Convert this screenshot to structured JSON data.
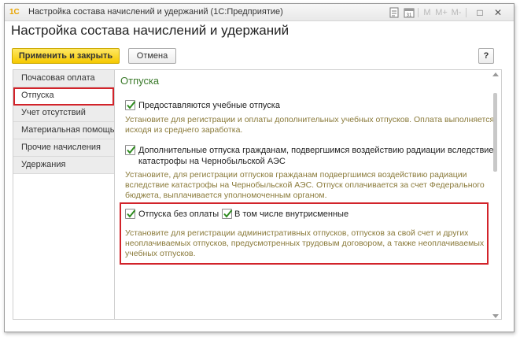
{
  "window": {
    "app_logo": "1С",
    "title": "Настройка состава начислений и удержаний (1С:Предприятие)",
    "toolbar_icons": [
      "document-icon",
      "calendar-icon",
      "memory-m-icon",
      "memory-m-plus-icon",
      "memory-m-minus-icon",
      "restore-icon",
      "close-icon"
    ],
    "mem_m": "M",
    "mem_mplus": "M+",
    "mem_mminus": "M-",
    "restore_glyph": "□",
    "close_glyph": "✕"
  },
  "form": {
    "title": "Настройка состава начислений и удержаний",
    "apply_button": "Применить и закрыть",
    "cancel_button": "Отмена",
    "help_button": "?"
  },
  "sidebar": {
    "items": [
      {
        "label": "Почасовая оплата"
      },
      {
        "label": "Отпуска"
      },
      {
        "label": "Учет отсутствий"
      },
      {
        "label": "Материальная помощь"
      },
      {
        "label": "Прочие начисления"
      },
      {
        "label": "Удержания"
      }
    ],
    "active_index": 1
  },
  "content": {
    "section_title": "Отпуска",
    "options": [
      {
        "label": "Предоставляются учебные отпуска",
        "checked": true,
        "hint_lines": [
          "Установите для регистрации и оплаты дополнительных учебных отпусков. Оплата выполняется",
          "исходя из среднего заработка."
        ]
      },
      {
        "label_lines": [
          "Дополнительные отпуска гражданам, подвергшимся воздействию радиации вследствие",
          "катастрофы на Чернобыльской АЭС"
        ],
        "checked": true,
        "hint_lines": [
          "Установите, для регистрации отпусков гражданам подвергшимся воздействию радиации",
          "вследствие катастрофы на Чернобыльской АЭС. Отпуск оплачивается за счет Федерального",
          "бюджета, выплачивается уполномоченным органом."
        ]
      },
      {
        "label": "Отпуска без оплаты",
        "checked": true,
        "sub_label": "В том числе внутрисменные",
        "sub_checked": true,
        "hint_lines": [
          "Установите для регистрации административных отпусков, отпусков за свой счет и других",
          "неоплачиваемых отпусков, предусмотренных трудовым договором, а также неоплачиваемых",
          "учебных отпусков."
        ]
      }
    ]
  },
  "colors": {
    "accent_yellow": "#f6c900",
    "section_green": "#3a7a2a",
    "hint_text": "#8a7a3a",
    "highlight_red": "#d2232a",
    "check_green": "#2e8b1e"
  }
}
